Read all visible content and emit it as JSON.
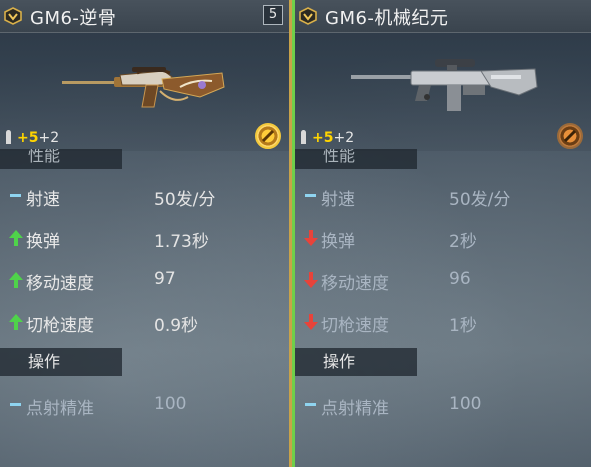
{
  "left": {
    "title": "GM6-逆骨",
    "badge": "5",
    "ammo": {
      "base": "+5",
      "extra": "+2"
    },
    "section_stats": "性能",
    "stats": [
      {
        "label": "射速",
        "value": "50发/分",
        "trend": "same"
      },
      {
        "label": "换弹",
        "value": "1.73秒",
        "trend": "up"
      },
      {
        "label": "移动速度",
        "value": "97",
        "trend": "up"
      },
      {
        "label": "切枪速度",
        "value": "0.9秒",
        "trend": "up"
      }
    ],
    "section_ops": "操作",
    "ops": [
      {
        "label": "点射精准",
        "value": "100",
        "trend": "same"
      }
    ],
    "accent": "#c8a24a"
  },
  "right": {
    "title": "GM6-机械纪元",
    "ammo": {
      "base": "+5",
      "extra": "+2"
    },
    "section_stats": "性能",
    "stats": [
      {
        "label": "射速",
        "value": "50发/分",
        "trend": "same"
      },
      {
        "label": "换弹",
        "value": "2秒",
        "trend": "down"
      },
      {
        "label": "移动速度",
        "value": "96",
        "trend": "down"
      },
      {
        "label": "切枪速度",
        "value": "1秒",
        "trend": "down"
      }
    ],
    "section_ops": "操作",
    "ops": [
      {
        "label": "点射精准",
        "value": "100",
        "trend": "same"
      }
    ],
    "accent": "#6fcf4a"
  },
  "colors": {
    "up": "#4fd34a",
    "down": "#e8433a",
    "same": "#8fd4f0",
    "gold_ammo": "#ffd400"
  },
  "icons": {
    "rank": "rank-chevron-icon",
    "bullet": "bullet-icon",
    "mod": "attachment-coin-icon"
  }
}
